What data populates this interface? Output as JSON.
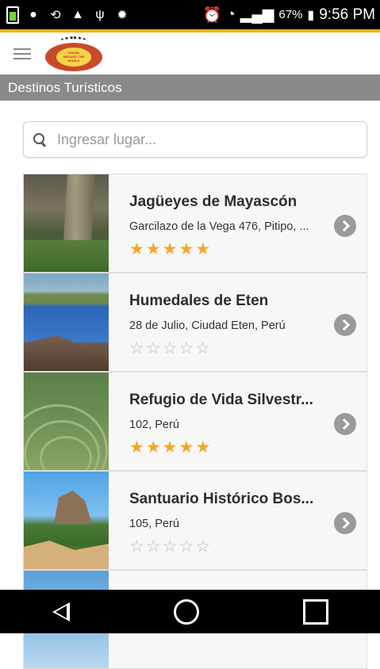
{
  "status_bar": {
    "battery_percent": "67%",
    "time": "9:56 PM",
    "icons": [
      "battery-icon",
      "notification-icon",
      "sync-icon",
      "alert-icon",
      "usb-icon",
      "bug-icon",
      "alarm-icon",
      "wifi-icon",
      "signal-icon"
    ]
  },
  "app_bar": {
    "logo_text": "TRAVEL AROUND THE WORLD"
  },
  "section": {
    "title": "Destinos Turísticos"
  },
  "search": {
    "placeholder": "Ingresar lugar...",
    "value": ""
  },
  "places": [
    {
      "name": "Jagüeyes de Mayascón",
      "address": "Garcilazo de la Vega 476, Pitipo, ...",
      "rating": 5
    },
    {
      "name": "Humedales de Eten",
      "address": "28 de Julio, Ciudad Eten, Perú",
      "rating": 0
    },
    {
      "name": "Refugio de Vida Silvestr...",
      "address": "102, Perú",
      "rating": 5
    },
    {
      "name": "Santuario Histórico Bos...",
      "address": "105, Perú",
      "rating": 0
    },
    {
      "name": "",
      "address": "",
      "rating": 0
    }
  ],
  "colors": {
    "accent": "#f3b316",
    "header_gray": "#8a8a8a",
    "star_on": "#f6a623",
    "star_off": "#bdbdbd"
  }
}
